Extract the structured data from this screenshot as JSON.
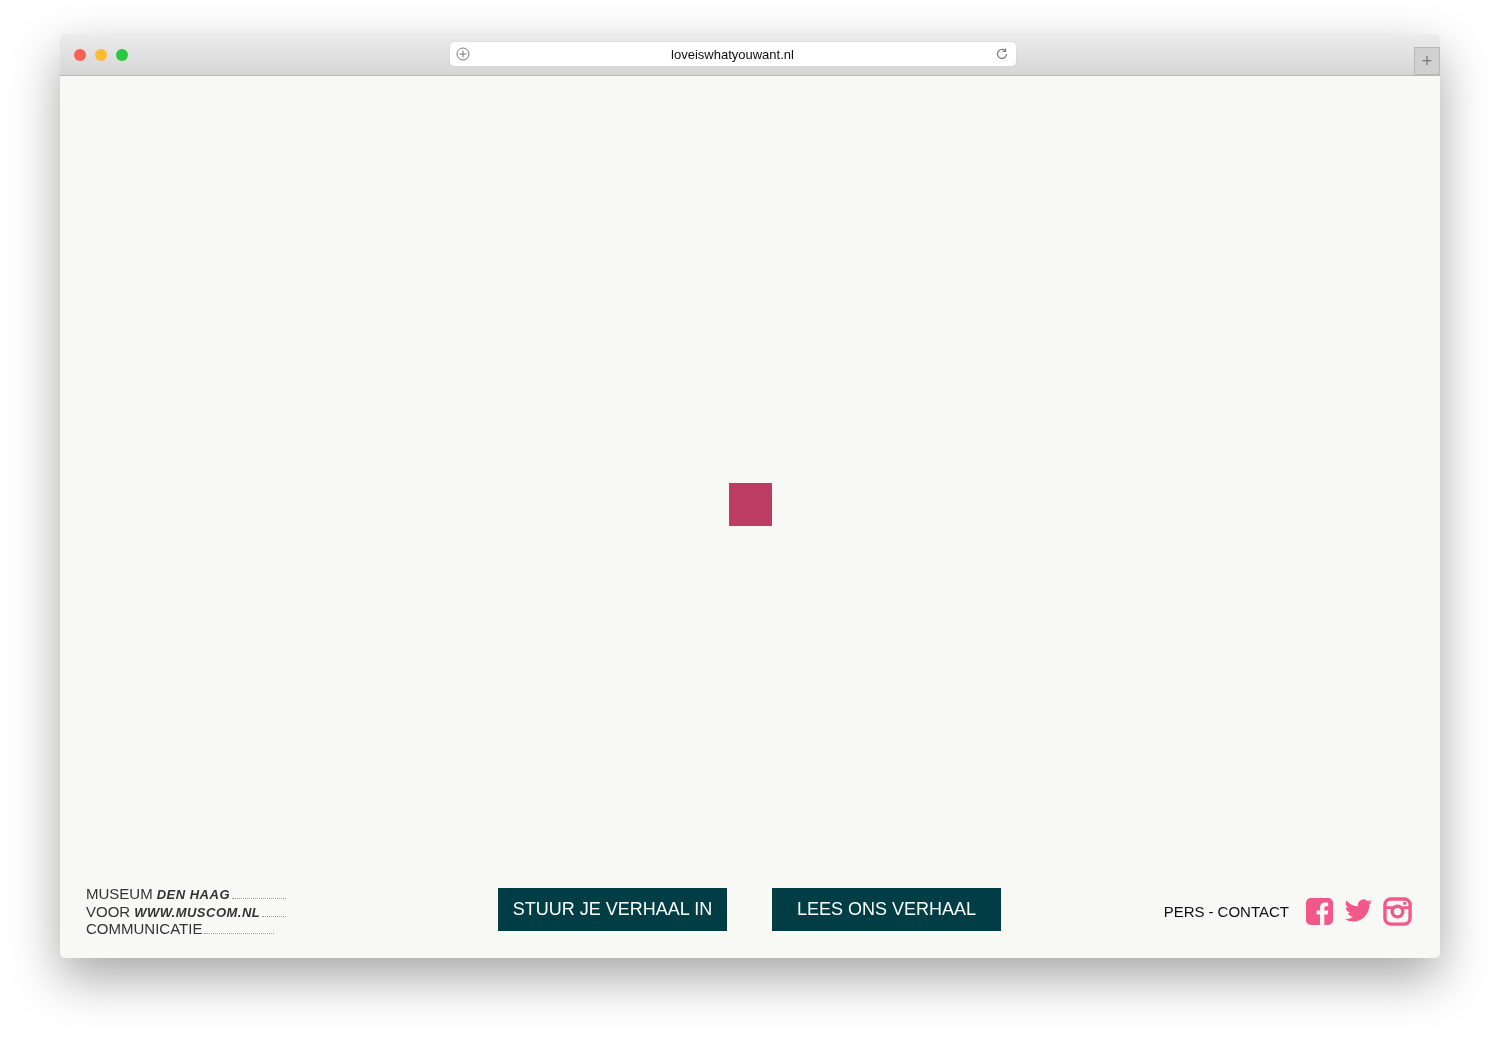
{
  "browser": {
    "url": "loveiswhatyouwant.nl",
    "new_tab": "+"
  },
  "logo": {
    "lines": [
      {
        "label": "MUSEUM",
        "handwritten": "DEN HAAG"
      },
      {
        "label": "VOOR",
        "handwritten": "WWW.MUSCOM.NL"
      },
      {
        "label": "COMMUNICATIE"
      }
    ]
  },
  "buttons": [
    {
      "label": "STUUR JE VERHAAL IN"
    },
    {
      "label": "LEES ONS VERHAAL"
    }
  ],
  "footer": {
    "links": [
      {
        "label": "PERS"
      },
      {
        "label": "CONTACT"
      }
    ],
    "separator": "-"
  }
}
